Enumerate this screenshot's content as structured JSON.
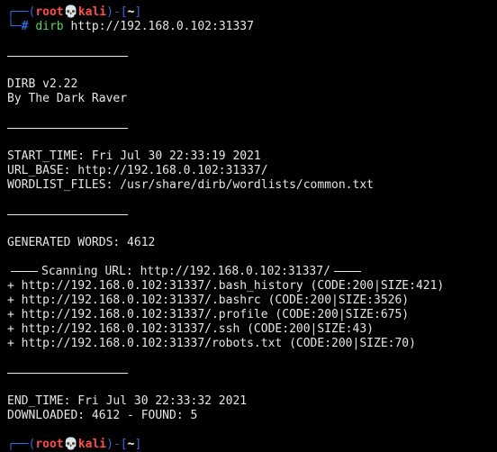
{
  "prompt": {
    "user": "root",
    "host": "kali",
    "cwd": "~",
    "symbol": "#",
    "skull": "💀"
  },
  "command": {
    "name": "dirb",
    "args": "http://192.168.0.102:31337"
  },
  "banner": {
    "version": "DIRB v2.22",
    "author": "By The Dark Raver"
  },
  "info": {
    "start_time": "START_TIME: Fri Jul 30 22:33:19 2021",
    "url_base": "URL_BASE: http://192.168.0.102:31337/",
    "wordlist": "WORDLIST_FILES: /usr/share/dirb/wordlists/common.txt"
  },
  "generated_words": "GENERATED WORDS: 4612",
  "scanning": "Scanning URL: http://192.168.0.102:31337/",
  "results": [
    "+ http://192.168.0.102:31337/.bash_history (CODE:200|SIZE:421)",
    "+ http://192.168.0.102:31337/.bashrc (CODE:200|SIZE:3526)",
    "+ http://192.168.0.102:31337/.profile (CODE:200|SIZE:675)",
    "+ http://192.168.0.102:31337/.ssh (CODE:200|SIZE:43)",
    "+ http://192.168.0.102:31337/robots.txt (CODE:200|SIZE:70)"
  ],
  "summary": {
    "end_time": "END_TIME: Fri Jul 30 22:33:32 2021",
    "downloaded": "DOWNLOADED: 4612 - FOUND: 5"
  },
  "colors": {
    "background": "#000000",
    "text": "#e6e6e6",
    "prompt_frame": "#2f6bd8",
    "prompt_user": "#ff4d4d",
    "command": "#57d657"
  }
}
